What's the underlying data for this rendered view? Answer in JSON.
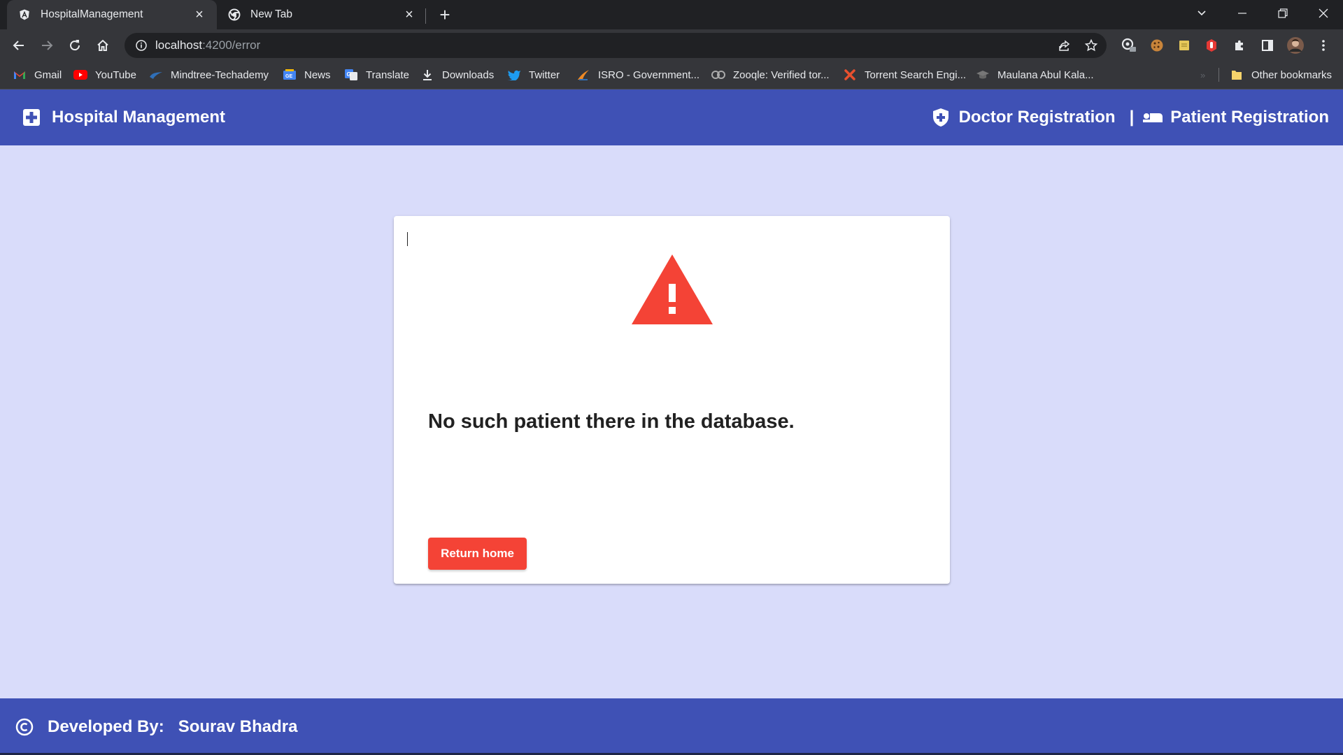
{
  "browser": {
    "tabs": [
      {
        "title": "HospitalManagement",
        "active": true,
        "icon": "angular-icon"
      },
      {
        "title": "New Tab",
        "active": false,
        "icon": "chrome-icon"
      }
    ],
    "url_host": "localhost",
    "url_path": ":4200/error",
    "bookmarks": [
      {
        "label": "Gmail",
        "icon": "gmail-icon"
      },
      {
        "label": "YouTube",
        "icon": "youtube-icon"
      },
      {
        "label": "Mindtree-Techademy",
        "icon": "mindtree-icon"
      },
      {
        "label": "News",
        "icon": "google-news-icon"
      },
      {
        "label": "Translate",
        "icon": "translate-icon"
      },
      {
        "label": "Downloads",
        "icon": "download-icon"
      },
      {
        "label": "Twitter",
        "icon": "twitter-icon"
      },
      {
        "label": "ISRO - Government...",
        "icon": "isro-icon"
      },
      {
        "label": "Zooqle: Verified tor...",
        "icon": "zooqle-icon"
      },
      {
        "label": "Torrent Search Engi...",
        "icon": "torrent-icon"
      },
      {
        "label": "Maulana Abul Kala...",
        "icon": "graduation-cap-icon"
      }
    ],
    "other_bookmarks": "Other bookmarks"
  },
  "app": {
    "brand": "Hospital Management",
    "nav": {
      "doctor_registration": "Doctor Registration",
      "separator": "|",
      "patient_registration": "Patient Registration"
    },
    "error": {
      "message": "No such patient there in the database.",
      "button": "Return home"
    },
    "footer": {
      "label": "Developed By:",
      "author": "Sourav Bhadra"
    }
  },
  "colors": {
    "primary": "#3f51b5",
    "background": "#d9dcfa",
    "warn": "#f44336"
  }
}
